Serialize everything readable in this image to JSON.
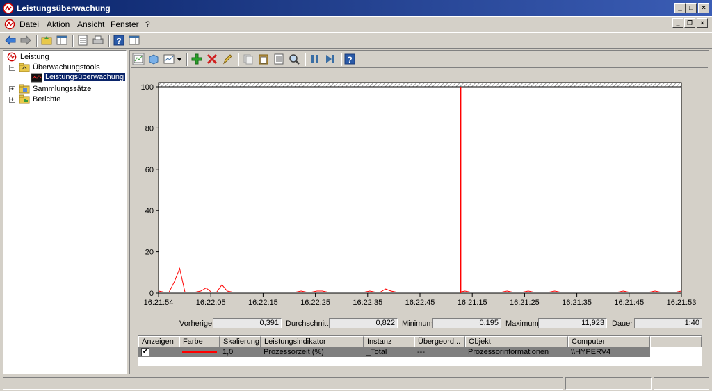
{
  "window": {
    "title": "Leistungsüberwachung"
  },
  "menu": {
    "items": [
      "Datei",
      "Aktion",
      "Ansicht",
      "Fenster",
      "?"
    ]
  },
  "tree": {
    "root": "Leistung",
    "items": [
      {
        "label": "Überwachungstools",
        "expander": "−"
      },
      {
        "label": "Leistungsüberwachung",
        "selected": true
      },
      {
        "label": "Sammlungssätze",
        "expander": "+"
      },
      {
        "label": "Berichte",
        "expander": "+"
      }
    ]
  },
  "stats": {
    "last_label": "Vorherige",
    "last_value": "0,391",
    "avg_label": "Durchschnitt",
    "avg_value": "0,822",
    "min_label": "Minimum",
    "min_value": "0,195",
    "max_label": "Maximum",
    "max_value": "11,923",
    "dur_label": "Dauer",
    "dur_value": "1:40"
  },
  "legend": {
    "headers": [
      "Anzeigen",
      "Farbe",
      "Skalierung",
      "Leistungsindikator",
      "Instanz",
      "Übergeord...",
      "Objekt",
      "Computer"
    ],
    "row": {
      "show": "✔",
      "scale": "1,0",
      "counter": "Prozessorzeit (%)",
      "instance": "_Total",
      "parent": "---",
      "object": "Prozessorinformationen",
      "computer": "\\\\HYPERV4"
    }
  },
  "colors": {
    "series": "#ff0000",
    "titlebar": "#0a246a",
    "selection": "#0a246a"
  },
  "chart_data": {
    "type": "line",
    "title": "",
    "xlabel": "",
    "ylabel": "",
    "ylim": [
      0,
      100
    ],
    "yticks": [
      0,
      20,
      40,
      60,
      80,
      100
    ],
    "xticks": [
      "16:21:54",
      "16:22:05",
      "16:22:15",
      "16:22:25",
      "16:22:35",
      "16:22:45",
      "16:21:15",
      "16:21:25",
      "16:21:35",
      "16:21:45",
      "16:21:53"
    ],
    "grid": false,
    "current_time_marker_tick_index": 5.78,
    "series": [
      {
        "name": "Prozessorzeit (%)",
        "values": [
          1.0,
          0.5,
          0.5,
          5.5,
          11.9,
          0.5,
          0.5,
          0.5,
          1.0,
          2.5,
          0.5,
          0.5,
          4.0,
          1.0,
          0.5,
          0.5,
          0.5,
          0.5,
          0.5,
          0.5,
          0.5,
          0.5,
          0.5,
          0.5,
          0.5,
          0.5,
          0.5,
          1.0,
          0.5,
          0.5,
          1.0,
          1.0,
          0.5,
          0.5,
          0.5,
          0.5,
          0.5,
          0.5,
          0.5,
          0.5,
          1.0,
          0.5,
          0.5,
          2.0,
          1.0,
          0.5,
          0.5,
          0.5,
          0.5,
          0.5,
          0.5,
          0.5,
          0.5,
          0.5,
          0.5,
          0.5,
          0.5,
          0.5,
          1.0,
          0.5,
          0.5,
          0.5,
          0.5,
          0.5,
          0.5,
          0.5,
          1.0,
          0.5,
          0.5,
          0.5,
          1.0,
          0.5,
          0.5,
          0.5,
          0.5,
          1.0,
          0.5,
          0.5,
          0.5,
          0.5,
          0.5,
          0.5,
          0.5,
          0.5,
          0.5,
          0.5,
          0.5,
          0.5,
          1.0,
          0.5,
          0.5,
          0.5,
          0.5,
          0.5,
          1.0,
          0.5,
          0.5,
          0.5,
          0.5,
          1.0
        ]
      }
    ]
  }
}
